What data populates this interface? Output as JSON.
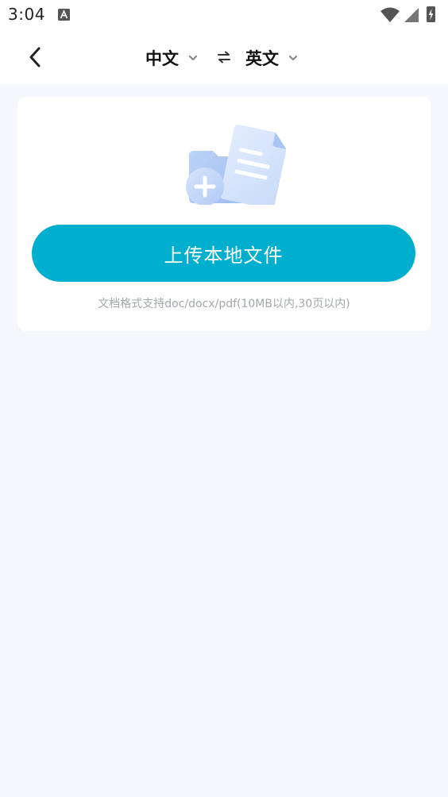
{
  "status_bar": {
    "time": "3:04",
    "icons": [
      "text-a-icon",
      "wifi-icon",
      "signal-icon",
      "battery-charging-icon"
    ]
  },
  "header": {
    "back_icon": "chevron-left-icon",
    "source_language": "中文",
    "target_language": "英文",
    "swap_icon": "swap-arrows-icon",
    "dropdown_icon": "chevron-down-icon"
  },
  "upload_card": {
    "illustration": "folder-document-add-icon",
    "button_label": "上传本地文件",
    "hint": "文档格式支持doc/docx/pdf(10MB以内,30页以内)"
  },
  "colors": {
    "accent": "#00aecd",
    "page_background": "#f5f7fa",
    "card_background": "#ffffff",
    "hint_text": "#a3a7ad"
  }
}
